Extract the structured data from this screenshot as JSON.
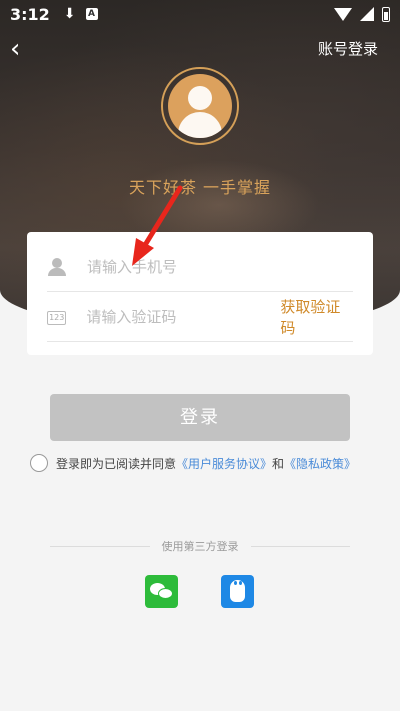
{
  "status_bar": {
    "time": "3:12",
    "download_icon": "download-icon",
    "a_badge": "A",
    "icons": [
      "wifi-icon",
      "signal-icon",
      "battery-icon"
    ]
  },
  "header": {
    "back_icon": "chevron-left-icon",
    "back_glyph": "‹",
    "account_login": "账号登录"
  },
  "brand": {
    "slogan": "天下好茶 一手掌握",
    "accent_color": "#d9a35b"
  },
  "form": {
    "phone_placeholder": "请输入手机号",
    "code_placeholder": "请输入验证码",
    "code_icon_text": "123",
    "get_code": "获取验证码"
  },
  "login_button": "登录",
  "agreement": {
    "prefix": "登录即为已阅读并同意",
    "terms_link": "《用户服务协议》",
    "conjunction": "和",
    "privacy_link": "《隐私政策》"
  },
  "third_party": {
    "label": "使用第三方登录",
    "providers": [
      "wechat-icon",
      "qq-icon"
    ]
  },
  "annotation": {
    "arrow_color": "#e8261c"
  }
}
